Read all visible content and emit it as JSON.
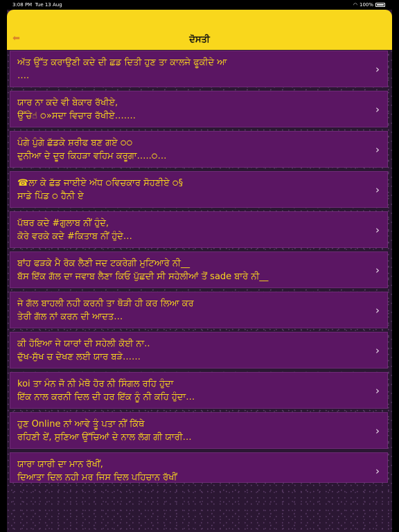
{
  "status": {
    "time": "3:08 PM",
    "date": "Tue 13 Aug",
    "battery": "100%"
  },
  "navbar": {
    "title": "ਦੋਸਤੀ",
    "back_icon": "arrow-left-icon"
  },
  "items": [
    {
      "text": "ਅੱਤ ਉੱਤ ਕਰਾਉਣੀ ਕਦੇ ਦੀ ਛਡ ਦਿਤੀ ਹੁਣ ਤਾ ਕਾਲਜੇ ਫੂਕੀਦੇ ਆ\n…."
    },
    {
      "text": "ਯਾਰ ਨਾ ਕਦੇ ਵੀ ਬੇਕਾਰ ਰੱਖੀਏ,\nਉੱਚੇ☝ ੦»ਸਦਾ ਵਿਚਾਰ ਰੱਖੀਏ……."
    },
    {
      "text": "ਪੰਗੇ ਪੁੰਗੇ ਛੱਡਕੇ ਸ਼ਰੀਫ ਬਣ ਗਏ ੦੦\nਦੁਨੀਆ ਦੇ ਦੂਰ ਕਿਹੜਾ ਵਹਿਮ ਕਰੂਗਾ…..੦…"
    },
    {
      "text": "☎ਲਾ ਕੇ ਛੱਡ ਜਾਈਏ ਅੱਧ ੦ਵਿਚਕਾਰ ਸੋਹਣੀਏ ੦§\nਸਾਡੇ ਪਿੰਡ ੦ ਹੈਨੀ ਏ"
    },
    {
      "text": "ਪੱਥਰ ਕਦੇ #ਗੁਲਾਬ ਨੀਂ ਹੁੰਦੇ,\nਕੋਰੇ ਵਰਕੇ ਕਦੇ #ਕਿਤਾਬ ਨੀਂ ਹੁੰਦੇ…"
    },
    {
      "text": "ਬਾਂਹ ਫੜਕੇ ਮੈ ਰੋਕ ਲੈਣੀ ਜਦ ਟਕਰੇਗੀ ਮੁਟਿਆਰੇ ਨੀ__\nਬੱਸ ਇੱਕ ਗੱਲ ਦਾ ਜਵਾਬ ਲੈਣਾ ਕਿਓ ਪੁੱਛਦੀ ਸੀ ਸਹੇਲੀਆਂ ਤੋਂ sade ਬਾਰੇ ਨੀ__"
    },
    {
      "text": "ਜੇ ਗੱਲ ਬਾਹਲੀ ਨਹੀ ਕਰਨੀ ਤਾ ਥੋੜੀ ਹੀ ਕਰ ਲਿਆ ਕਰ\nਤੇਰੀ ਗੱਲ ਨਾਂ ਕਰਨ ਦੀ ਆਦਤ…"
    },
    {
      "text": "ਕੀ ਹੋਇਆ ਜੇ ਯਾਰਾਂ ਦੀ ਸਹੇਲੀ ਕੋਈ ਨਾ..\nਦੁੱਖ-ਸੁੱਖ ਚ ਦੇਖਣ ਲਈ ਯਾਰ ਬੜੇ……"
    },
    {
      "text": "koi ਤਾ ਮੰਨ ਜੋ ਨੀ ਮੇਥੋ ਹੋਰ ਨੀ ਸਿੰਗਲ ਰਹਿ ਹੁੰਦਾ\nਇੱਕ ਨਾਲ ਕਰਨੀ ਦਿਲ ਦੀ ਹਰ ਇੱਕ ਨੂੰ ਨੀ ਕਹਿ ਹੁੰਦਾ…"
    },
    {
      "text": "ਹੁਣ Online ਨਾਂ ਆਵੇ ਤੂੰ ਪਤਾ ਨੀਂ ਕਿੱਥੇ\nਰਹਿਣੀ ਏਂ, ਸੁਣਿਆ ਉੱਚਿਆਂ ਦੇ ਨਾਲ ਲੱਗ ਗੀ ਯਾਰੀ…"
    },
    {
      "text": "ਯਾਰਾ ਯਾਰੀ ਦਾ ਮਾਨ ਰੱਖੀਂ,\nਦਿਆਤਾ ਦਿਲ ਨਹੀ ਮਰ ਜਿਸ ਦਿਲ ਪਹਿਚਾਨ ਰੱਖੀਂ"
    }
  ],
  "chevron_icon": "chevron-right-icon",
  "colors": {
    "navbar": "#f9d71c",
    "row_bg": "#5b1663",
    "text": "#f9d71c"
  }
}
